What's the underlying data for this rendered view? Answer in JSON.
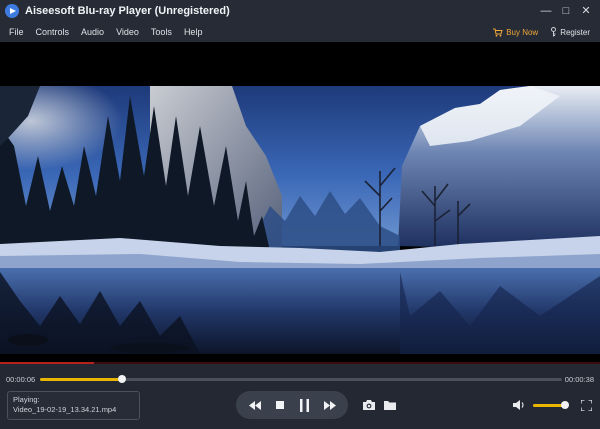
{
  "window": {
    "title": "Aiseesoft Blu-ray Player (Unregistered)",
    "minimize_glyph": "—",
    "maximize_glyph": "□",
    "close_glyph": "✕"
  },
  "menu": {
    "items": [
      "File",
      "Controls",
      "Audio",
      "Video",
      "Tools",
      "Help"
    ],
    "buy_now": "Buy Now",
    "register": "Register"
  },
  "playback": {
    "elapsed": "00:00:06",
    "total": "00:00:38",
    "progress_fraction": 0.157,
    "volume_fraction": 0.9,
    "now_playing_label": "Playing:",
    "file_name": "Video_19-02-19_13.34.21.mp4"
  },
  "colors": {
    "accent": "#e8b600",
    "buy_now": "#f2a838"
  },
  "icons": {
    "buy_now": "cart-icon",
    "register": "key-icon",
    "transport": [
      "rewind-icon",
      "stop-icon",
      "pause-icon",
      "fast-forward-icon"
    ],
    "snapshot": "camera-icon",
    "open": "folder-icon",
    "volume": "speaker-icon",
    "fullscreen": "fullscreen-icon"
  }
}
